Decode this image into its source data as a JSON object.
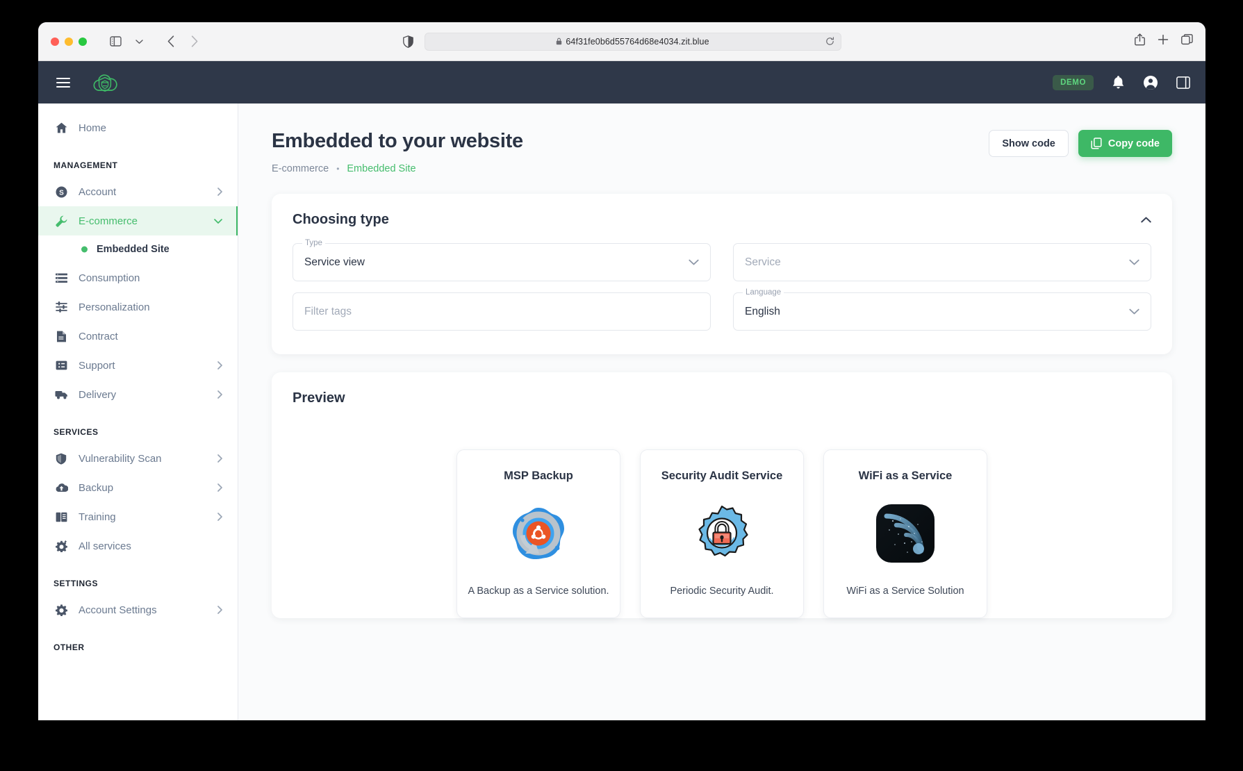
{
  "browser": {
    "url": "64f31fe0b6d55764d68e4034.zit.blue",
    "lock_icon": "lock-icon",
    "shield_icon": "shield-icon",
    "reload_icon": "reload-icon",
    "back_icon": "back-arrow-icon",
    "forward_icon": "forward-arrow-icon",
    "sidebar_toggle_icon": "sidebar-toggle-icon",
    "share_icon": "share-icon",
    "new_tab_icon": "plus-icon",
    "tabs_icon": "tab-overview-icon"
  },
  "app_header": {
    "menu_icon": "hamburger-menu-icon",
    "logo_icon": "cloud-shield-logo",
    "demo_badge": "DEMO",
    "bell_icon": "bell-icon",
    "account_icon": "account-circle-icon",
    "panel_icon": "right-panel-icon"
  },
  "sidebar": {
    "home": {
      "label": "Home",
      "icon": "home-icon"
    },
    "sections": [
      {
        "title": "MANAGEMENT",
        "items": [
          {
            "label": "Account",
            "icon": "dollar-circle-icon",
            "arrow": true,
            "active": false
          },
          {
            "label": "E-commerce",
            "icon": "wrench-icon",
            "arrow": true,
            "active": true,
            "expanded": true
          },
          {
            "label": "Consumption",
            "icon": "list-icon",
            "arrow": false,
            "active": false
          },
          {
            "label": "Personalization",
            "icon": "sliders-icon",
            "arrow": false,
            "active": false
          },
          {
            "label": "Contract",
            "icon": "document-icon",
            "arrow": false,
            "active": false
          },
          {
            "label": "Support",
            "icon": "ticket-icon",
            "arrow": true,
            "active": false
          },
          {
            "label": "Delivery",
            "icon": "truck-icon",
            "arrow": true,
            "active": false
          }
        ]
      },
      {
        "title": "SERVICES",
        "items": [
          {
            "label": "Vulnerability Scan",
            "icon": "shield-icon",
            "arrow": true,
            "active": false
          },
          {
            "label": "Backup",
            "icon": "cloud-upload-icon",
            "arrow": true,
            "active": false
          },
          {
            "label": "Training",
            "icon": "book-icon",
            "arrow": true,
            "active": false
          },
          {
            "label": "All services",
            "icon": "gear-plus-icon",
            "arrow": false,
            "active": false
          }
        ]
      },
      {
        "title": "SETTINGS",
        "items": [
          {
            "label": "Account Settings",
            "icon": "gear-icon",
            "arrow": true,
            "active": false
          }
        ]
      },
      {
        "title": "OTHER",
        "items": []
      }
    ],
    "submenu": {
      "label": "Embedded Site",
      "parent": "E-commerce"
    }
  },
  "page": {
    "title": "Embedded to your website",
    "breadcrumb": {
      "parent": "E-commerce",
      "separator": "•",
      "current": "Embedded Site"
    },
    "actions": {
      "show_code": "Show code",
      "copy_code": "Copy code",
      "copy_icon": "copy-icon"
    }
  },
  "choosing_type": {
    "title": "Choosing type",
    "collapse_icon": "chevron-up-icon",
    "fields": [
      {
        "name": "type",
        "label": "Type",
        "value": "Service view",
        "placeholder": "",
        "caret": "chevron-down-icon"
      },
      {
        "name": "service",
        "label": "",
        "value": "",
        "placeholder": "Service",
        "caret": "chevron-down-icon"
      },
      {
        "name": "filter_tags",
        "label": "",
        "value": "",
        "placeholder": "Filter tags",
        "caret": ""
      },
      {
        "name": "language",
        "label": "Language",
        "value": "English",
        "placeholder": "",
        "caret": "chevron-down-icon"
      }
    ]
  },
  "preview": {
    "title": "Preview",
    "tiles": [
      {
        "title": "MSP Backup",
        "desc": "A Backup as a Service solution.",
        "icon": "backup-circular-arrows-icon"
      },
      {
        "title": "Security Audit Service",
        "desc": "Periodic Security Audit.",
        "icon": "gear-padlock-icon"
      },
      {
        "title": "WiFi as a Service",
        "desc": "WiFi as a Service Solution",
        "icon": "wifi-signal-icon"
      }
    ]
  },
  "colors": {
    "accent_green": "#3eb866",
    "header_dark": "#2f3849",
    "text_dark": "#2b3445",
    "muted": "#7d8899"
  }
}
